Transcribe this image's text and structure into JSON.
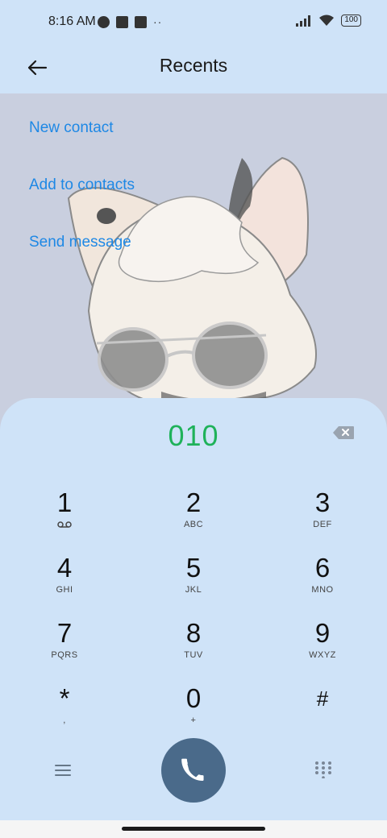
{
  "status_bar": {
    "time": "8:16 AM",
    "battery": "100"
  },
  "header": {
    "title": "Recents"
  },
  "actions": {
    "new_contact": "New contact",
    "add_to_contacts": "Add to contacts",
    "send_message": "Send message"
  },
  "dialer": {
    "number": "010",
    "keys": [
      {
        "digit": "1",
        "letters": ""
      },
      {
        "digit": "2",
        "letters": "ABC"
      },
      {
        "digit": "3",
        "letters": "DEF"
      },
      {
        "digit": "4",
        "letters": "GHI"
      },
      {
        "digit": "5",
        "letters": "JKL"
      },
      {
        "digit": "6",
        "letters": "MNO"
      },
      {
        "digit": "7",
        "letters": "PQRS"
      },
      {
        "digit": "8",
        "letters": "TUV"
      },
      {
        "digit": "9",
        "letters": "WXYZ"
      },
      {
        "digit": "*",
        "letters": ","
      },
      {
        "digit": "0",
        "letters": "+"
      },
      {
        "digit": "#",
        "letters": ""
      }
    ]
  },
  "icons": {
    "back": "back-arrow-icon",
    "backspace": "backspace-icon",
    "voicemail": "voicemail-icon",
    "menu": "menu-icon",
    "call": "phone-icon",
    "keypad": "keypad-grid-icon"
  },
  "colors": {
    "background": "#cfe3f8",
    "link": "#1e88e5",
    "dialed_number": "#1fb25a",
    "call_button": "#4a6a8a"
  }
}
